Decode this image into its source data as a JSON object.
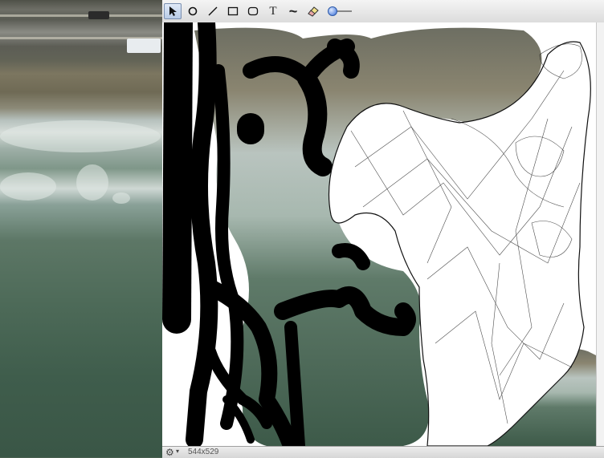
{
  "toolbar": {
    "tools": [
      {
        "id": "select",
        "icon": "arrow-pointer-icon",
        "selected": true
      },
      {
        "id": "ellipse",
        "icon": "circle-icon",
        "selected": false
      },
      {
        "id": "line",
        "icon": "line-icon",
        "selected": false
      },
      {
        "id": "rectangle",
        "icon": "rectangle-icon",
        "selected": false
      },
      {
        "id": "rounded-rectangle",
        "icon": "rounded-rectangle-icon",
        "selected": false
      },
      {
        "id": "text",
        "icon": "text-icon",
        "glyph": "T",
        "selected": false
      },
      {
        "id": "freehand",
        "icon": "squiggle-icon",
        "glyph": "~",
        "selected": false
      },
      {
        "id": "eraser",
        "icon": "eraser-icon",
        "selected": false
      }
    ],
    "brush_size_level": 0.1
  },
  "status": {
    "canvas_size": "544x529"
  },
  "colors": {
    "toolbar_bg": "#dcdcdc",
    "canvas_bg": "#ffffff",
    "ink": "#000000",
    "selected_tool": "#b8cbe6"
  }
}
